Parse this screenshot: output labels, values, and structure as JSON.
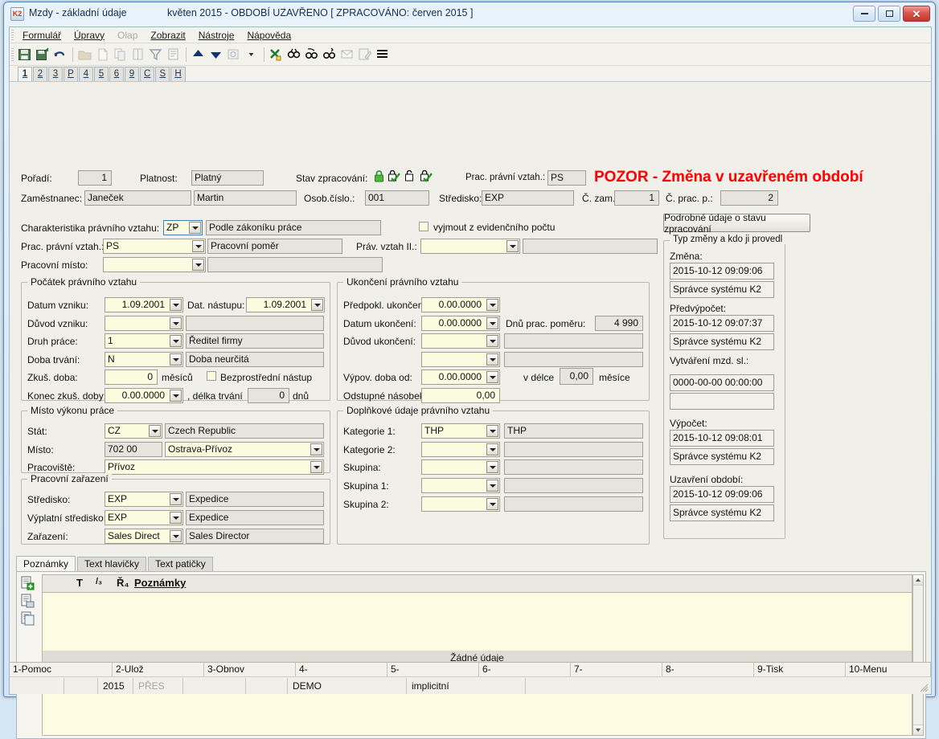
{
  "window": {
    "app_icon": "K2",
    "title": "Mzdy - základní údaje",
    "subtitle": "květen 2015 - OBDOBÍ UZAVŘENO [ ZPRACOVÁNO: červen 2015 ]",
    "minimize": "minimize-icon",
    "maximize": "maximize-icon",
    "close": "✕"
  },
  "menu": [
    {
      "label": "Formulář",
      "disabled": false
    },
    {
      "label": "Úpravy",
      "disabled": false
    },
    {
      "label": "Olap",
      "disabled": true
    },
    {
      "label": "Zobrazit",
      "disabled": false
    },
    {
      "label": "Nástroje",
      "disabled": false
    },
    {
      "label": "Nápověda",
      "disabled": false
    }
  ],
  "toolbar": [
    {
      "name": "save-icon"
    },
    {
      "name": "save-as-icon"
    },
    {
      "name": "undo-icon"
    },
    {
      "name": "open-folder-icon"
    },
    {
      "name": "new-document-icon"
    },
    {
      "name": "copy-icon"
    },
    {
      "name": "paste-icon"
    },
    {
      "name": "filter-icon"
    },
    {
      "name": "list-icon"
    },
    {
      "name": "arrow-up-icon"
    },
    {
      "name": "arrow-down-icon"
    },
    {
      "name": "refresh-icon"
    },
    {
      "name": "dropdown-arrow-icon"
    },
    {
      "name": "export-excel-icon"
    },
    {
      "name": "find-icon"
    },
    {
      "name": "find-prev-icon"
    },
    {
      "name": "find-next-icon"
    },
    {
      "name": "mail-icon"
    },
    {
      "name": "edit-note-icon"
    },
    {
      "name": "menu-lines-icon"
    }
  ],
  "numtabs": [
    {
      "label": "1",
      "active": true
    },
    {
      "label": "2",
      "active": false
    },
    {
      "label": "3",
      "active": false
    },
    {
      "label": "P",
      "active": false
    },
    {
      "label": "4",
      "active": false
    },
    {
      "label": "5",
      "active": false
    },
    {
      "label": "6",
      "active": false
    },
    {
      "label": "9",
      "active": false
    },
    {
      "label": "C",
      "active": false
    },
    {
      "label": "S",
      "active": false
    },
    {
      "label": "H",
      "active": false
    }
  ],
  "header": {
    "poradi_label": "Pořadí:",
    "poradi_value": "1",
    "platnost_label": "Platnost:",
    "platnost_value": "Platný",
    "stav_label": "Stav zpracování:",
    "stav_icons": [
      "padlock-green-icon",
      "locked-checked-icon",
      "unlocked-icon",
      "locked-checked-icon"
    ],
    "prac_vztah_label": "Prac. právní vztah.:",
    "prac_vztah_value": "PS",
    "warning": "POZOR - Změna v uzavřeném období",
    "zamestnanec_label": "Zaměstnanec:",
    "zamestnanec_surname": "Janeček",
    "zamestnanec_name": "Martin",
    "osob_cislo_label": "Osob.číslo.:",
    "osob_cislo_value": "001",
    "stredisko_label": "Středisko:",
    "stredisko_value": "EXP",
    "c_zam_label": "Č. zam.:",
    "c_zam_value": "1",
    "c_prac_p_label": "Č. prac. p.:",
    "c_prac_p_value": "2"
  },
  "characteristics": {
    "charakteristika_label": "Charakteristika právního vztahu:",
    "charakteristika_code": "ZP",
    "charakteristika_desc": "Podle zákoníku práce",
    "vyjmout_label": "vyjmout z evidenčního počtu",
    "vyjmout_checked": false,
    "prac_vztah_label": "Prac. právní vztah.:",
    "prac_vztah_code": "PS",
    "prac_vztah_desc": "Pracovní poměr",
    "prav_vztah2_label": "Práv. vztah II.:",
    "prav_vztah2_code": "",
    "prav_vztah2_desc": "",
    "pracovni_misto_label": "Pracovní místo:",
    "pracovni_misto_code": "",
    "pracovni_misto_desc": ""
  },
  "pocatek": {
    "title": "Počátek právního vztahu",
    "datum_vzniku_label": "Datum vzniku:",
    "datum_vzniku_value": "1.09.2001",
    "dat_nastupu_label": "Dat. nástupu:",
    "dat_nastupu_value": "1.09.2001",
    "duvod_vzniku_label": "Důvod vzniku:",
    "duvod_vzniku_code": "",
    "duvod_vzniku_desc": "",
    "druh_prace_label": "Druh práce:",
    "druh_prace_code": "1",
    "druh_prace_desc": "Ředitel firmy",
    "doba_trvani_label": "Doba trvání:",
    "doba_trvani_code": "N",
    "doba_trvani_desc": "Doba neurčitá",
    "zkus_doba_label": "Zkuš. doba:",
    "zkus_doba_value": "0",
    "zkus_doba_unit": "měsíců",
    "bezprostredni_label": "Bezprostřední nástup",
    "bezprostredni_checked": false,
    "konec_zkus_label": "Konec zkuš. doby:",
    "konec_zkus_value": "0.00.0000",
    "delka_trvani_label": ", délka trvání",
    "delka_trvani_value": "0",
    "delka_trvani_unit": "dnů"
  },
  "ukonceni": {
    "title": "Ukončení právního vztahu",
    "predpokl_label": "Předpokl. ukončení:",
    "predpokl_value": "0.00.0000",
    "datum_ukonceni_label": "Datum ukončení:",
    "datum_ukonceni_value": "0.00.0000",
    "dnu_prac_label": "Dnů prac. poměru:",
    "dnu_prac_value": "4 990",
    "duvod_ukonceni_label": "Důvod ukončení:",
    "duvod_ukonceni_code": "",
    "duvod_ukonceni_desc": "",
    "duvod_ukonceni2_code": "",
    "duvod_ukonceni2_desc": "",
    "vypov_doba_label": "Výpov. doba od:",
    "vypov_doba_value": "0.00.0000",
    "v_delce_label": "v délce",
    "v_delce_value": "0,00",
    "v_delce_unit": "měsíce",
    "odstupne_label": "Odstupné násobek:",
    "odstupne_value": "0,00"
  },
  "misto": {
    "title": "Místo výkonu práce",
    "stat_label": "Stát:",
    "stat_code": "CZ",
    "stat_desc": "Czech Republic",
    "misto_label": "Místo:",
    "misto_code": "702 00",
    "misto_desc": "Ostrava-Přívoz",
    "pracoviste_label": "Pracoviště:",
    "pracoviste_value": "Přívoz"
  },
  "zarazeni": {
    "title": "Pracovní zařazení",
    "stredisko_label": "Středisko:",
    "stredisko_code": "EXP",
    "stredisko_desc": "Expedice",
    "vyplatni_label": "Výplatní středisko:",
    "vyplatni_code": "EXP",
    "vyplatni_desc": "Expedice",
    "zarazeni_label": "Zařazení:",
    "zarazeni_code": "Sales Direct",
    "zarazeni_desc": "Sales Director"
  },
  "doplnkove": {
    "title": "Doplňkové údaje právního vztahu",
    "rows": [
      {
        "label": "Kategorie 1:",
        "code": "THP",
        "desc": "THP"
      },
      {
        "label": "Kategorie 2:",
        "code": "",
        "desc": ""
      },
      {
        "label": "Skupina:",
        "code": "",
        "desc": ""
      },
      {
        "label": "Skupina 1:",
        "code": "",
        "desc": ""
      },
      {
        "label": "Skupina 2:",
        "code": "",
        "desc": ""
      }
    ]
  },
  "rightpanel": {
    "button_label": "Podrobné údaje o stavu zpracování",
    "group_title": "Typ změny a kdo ji provedl",
    "entries": [
      {
        "label": "Změna:",
        "timestamp": "2015-10-12 09:09:06",
        "user": "Správce systému K2"
      },
      {
        "label": "Předvýpočet:",
        "timestamp": "2015-10-12 09:07:37",
        "user": "Správce systému K2"
      },
      {
        "label": "Vytváření mzd. sl.:",
        "timestamp": "0000-00-00 00:00:00",
        "user": ""
      },
      {
        "label": "Výpočet:",
        "timestamp": "2015-10-12 09:08:01",
        "user": "Správce systému K2"
      },
      {
        "label": "Uzavření období:",
        "timestamp": "2015-10-12 09:09:06",
        "user": "Správce systému K2"
      }
    ]
  },
  "notes": {
    "tabs": [
      {
        "label": "Poznámky",
        "active": true
      },
      {
        "label": "Text hlavičky",
        "active": false
      },
      {
        "label": "Text patičky",
        "active": false
      }
    ],
    "side_icons": [
      "new-note-icon",
      "open-note-icon",
      "copy-note-icon"
    ],
    "columns": [
      {
        "label": "T"
      },
      {
        "label": "/₃"
      },
      {
        "label": "Ř₄"
      },
      {
        "label": "Poznámky"
      }
    ],
    "empty_text": "Žádné údaje"
  },
  "fkeys": [
    {
      "label": "1-Pomoc"
    },
    {
      "label": "2-Ulož"
    },
    {
      "label": "3-Obnov"
    },
    {
      "label": "4-"
    },
    {
      "label": "5-"
    },
    {
      "label": "6-"
    },
    {
      "label": "7-"
    },
    {
      "label": "8-"
    },
    {
      "label": "9-Tisk"
    },
    {
      "label": "10-Menu"
    }
  ],
  "statusbar": {
    "cell1": "",
    "cell2": "",
    "year": "2015",
    "mode": "PŘES",
    "cell5": "",
    "cell6": "",
    "db": "DEMO",
    "profile": "implicitní",
    "cell9": ""
  },
  "colors": {
    "warning": "#ff0000",
    "field_readonly": "#e6e4dd",
    "field_editable": "#fbfbe0",
    "titlebar_text": "#10304f"
  }
}
